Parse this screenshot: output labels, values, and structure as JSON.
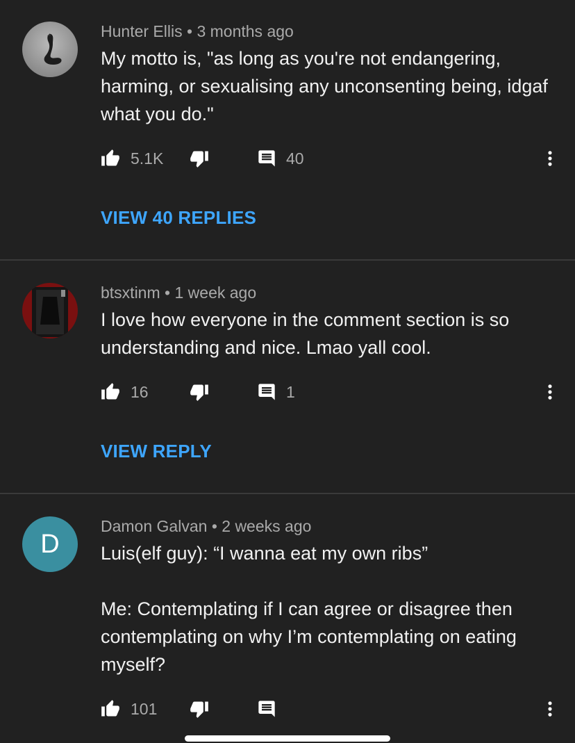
{
  "comments": [
    {
      "author": "Hunter Ellis",
      "separator": "•",
      "time": "3 months ago",
      "paragraphs": [
        "My motto is, \"as long as you're not endangering, harming, or sexualising any unconsenting being, idgaf what you do.\""
      ],
      "likes": "5.1K",
      "reply_count": "40",
      "replies_label": "VIEW 40 REPLIES"
    },
    {
      "author": "btsxtinm",
      "separator": "•",
      "time": "1 week ago",
      "paragraphs": [
        "I love how everyone in the comment section is so understanding and nice. Lmao yall cool."
      ],
      "likes": "16",
      "reply_count": "1",
      "replies_label": "VIEW REPLY"
    },
    {
      "author": "Damon Galvan",
      "separator": "•",
      "time": "2 weeks ago",
      "avatar_letter": "D",
      "paragraphs": [
        "Luis(elf guy): “I wanna eat my own ribs”",
        "Me: Contemplating if I can agree or disagree then contemplating on why I’m contemplating on eating myself?"
      ],
      "likes": "101",
      "reply_count": ""
    }
  ],
  "icons": {
    "like": "thumb-up-icon",
    "dislike": "thumb-down-icon",
    "reply": "comment-icon",
    "more": "more-vert-icon"
  },
  "colors": {
    "background": "#212121",
    "link": "#3ea6ff",
    "meta_text": "#aaaaaa",
    "avatar_d": "#3a8fa0"
  }
}
